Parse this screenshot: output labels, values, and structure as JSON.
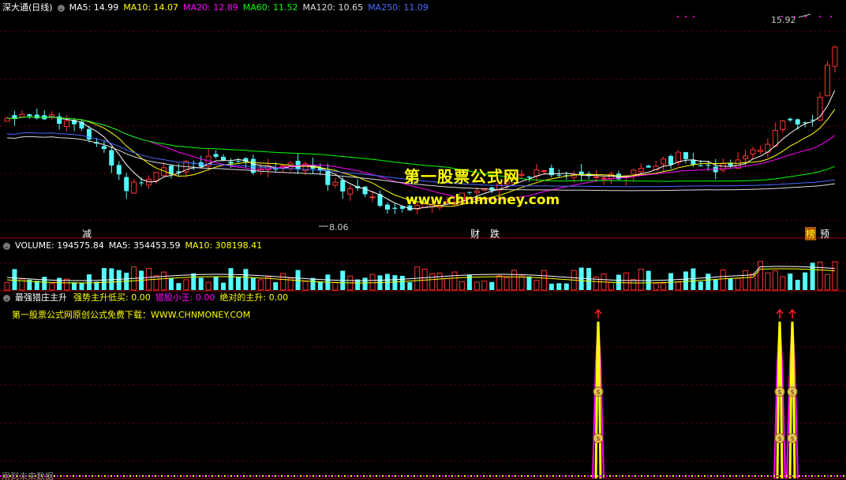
{
  "main_panel": {
    "title": "深大通(日线)",
    "ma_items": [
      {
        "label": "MA5: 14.99",
        "color": "#ffffff"
      },
      {
        "label": "MA10: 14.07",
        "color": "#ffff00"
      },
      {
        "label": "MA20: 12.89",
        "color": "#ff00ff"
      },
      {
        "label": "MA60: 11.52",
        "color": "#00ff00"
      },
      {
        "label": "MA120: 10.65",
        "color": "#dddddd"
      },
      {
        "label": "MA250: 11.09",
        "color": "#4a6cff"
      }
    ],
    "high_label": "15.92",
    "low_label": "8.06",
    "events": [
      {
        "text": "减"
      },
      {
        "text": "财"
      },
      {
        "text": "跌"
      },
      {
        "text": "榜"
      },
      {
        "text": "预"
      }
    ],
    "watermark_cn": "第一股票公式网",
    "watermark_url": "www.chnmoney.com"
  },
  "volume_panel": {
    "items": [
      {
        "label": "VOLUME: 194575.84",
        "color": "#ffffff"
      },
      {
        "label": "MA5: 354453.59",
        "color": "#ffffff"
      },
      {
        "label": "MA10: 308198.41",
        "color": "#ffff00"
      }
    ]
  },
  "indicator_panel": {
    "name": "最强猎庄主升",
    "items": [
      {
        "label": "强势主升低买: 0.00",
        "color": "#ffff00"
      },
      {
        "label": "猎股小王: 0.00",
        "color": "#ff00ff"
      },
      {
        "label": "绝对的主升: 0.00",
        "color": "#ffff00"
      }
    ],
    "note": "第一股票公式网原创公式免费下载：WWW.CHNMONEY.COM",
    "footer": "用到未来数据"
  },
  "icons": {
    "collapse": "chevron-down-icon",
    "signal": "up-arrow-icon",
    "coin": "money-bag-icon"
  },
  "colors": {
    "up": "#ff3232",
    "down": "#54fcfc",
    "grid": "#7a0000",
    "bg": "#000000"
  }
}
